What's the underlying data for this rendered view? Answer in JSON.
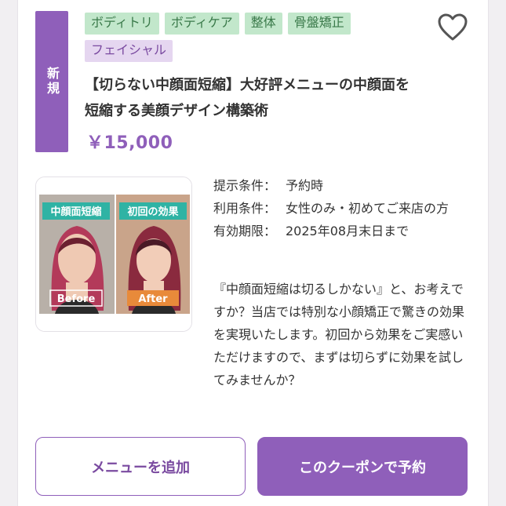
{
  "badge": {
    "new_label": "新規"
  },
  "tags": [
    {
      "label": "ボディトリ",
      "style": "green"
    },
    {
      "label": "ボディケア",
      "style": "green"
    },
    {
      "label": "整体",
      "style": "green"
    },
    {
      "label": "骨盤矯正",
      "style": "green"
    },
    {
      "label": "フェイシャル",
      "style": "purple"
    }
  ],
  "favorite_icon": "heart-outline-icon",
  "coupon": {
    "title": "【切らない中顔面短縮】大好評メニューの中顔面を短縮する美顔デザイン構築術",
    "price": "￥15,000"
  },
  "photo": {
    "label_left": "中顔面短縮",
    "label_right": "初回の効果",
    "before_label": "Before",
    "after_label": "After"
  },
  "conditions": [
    {
      "label": "提示条件：",
      "value": "予約時"
    },
    {
      "label": "利用条件：",
      "value": "女性のみ・初めてご来店の方"
    },
    {
      "label": "有効期限：",
      "value": "2025年08月末日まで"
    }
  ],
  "description": "『中顔面短縮は切るしかない』と、お考えですか？当店では特別な小顔矯正で驚きの効果を実現いたします。初回から効果をご実感いただけますので、まずは切らずに効果を試してみませんか？",
  "buttons": {
    "add_menu": "メニューを追加",
    "reserve": "このクーポンで予約"
  },
  "colors": {
    "accent": "#8f5fba",
    "tag_green_bg": "#c2e7cb",
    "tag_purple_bg": "#e5d6f0"
  }
}
